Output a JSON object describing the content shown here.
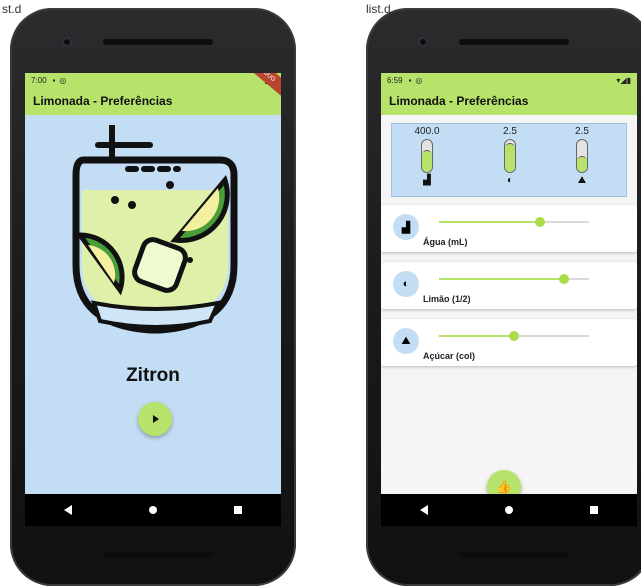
{
  "window": {
    "partial_title_left": "st.d",
    "partial_title_right": "list.d"
  },
  "colors": {
    "accent": "#b7e36a",
    "background_left": "#c2ddf4",
    "background_right": "#f5f5f5"
  },
  "left_phone": {
    "status_bar": {
      "time": "7:00",
      "icons": [
        "sim-icon",
        "notification-icon"
      ],
      "right_icons": "◢▮",
      "debug_banner": "DEBUG"
    },
    "app_bar": {
      "title": "Limonada - Preferências"
    },
    "product": {
      "name": "Zitron",
      "image_icon": "lemonade-glass-icon"
    },
    "play_button": {
      "icon": "play-icon"
    }
  },
  "right_phone": {
    "status_bar": {
      "time": "6:59",
      "icons": [
        "sim-icon",
        "notification-icon"
      ],
      "right_icons": "▾◢▮"
    },
    "app_bar": {
      "title": "Limonada - Preferências"
    },
    "summary": {
      "gauges": [
        {
          "value": "400.0",
          "fill_fraction": 0.7,
          "icon": "cup-icon"
        },
        {
          "value": "2.5",
          "fill_fraction": 0.9,
          "icon": "lemon-icon"
        },
        {
          "value": "2.5",
          "fill_fraction": 0.5,
          "icon": "sugar-icon"
        }
      ]
    },
    "preferences": [
      {
        "label": "Água (mL)",
        "icon": "cup-icon",
        "value_fraction": 0.67
      },
      {
        "label": "Limão (1/2)",
        "icon": "lemon-icon",
        "value_fraction": 0.83
      },
      {
        "label": "Açúcar (col)",
        "icon": "sugar-icon",
        "value_fraction": 0.5
      }
    ],
    "confirm_button": {
      "icon": "thumbs-up-icon"
    }
  }
}
